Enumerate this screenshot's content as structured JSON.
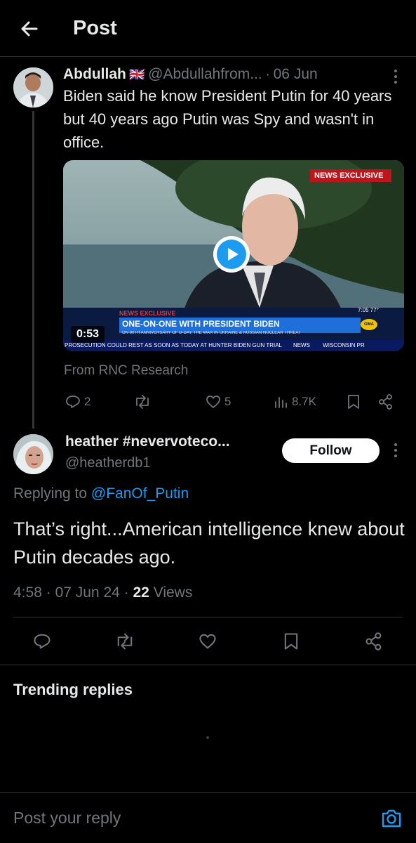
{
  "header": {
    "title": "Post"
  },
  "parent": {
    "name": "Abdullah",
    "flag": "🇬🇧",
    "handle": "@Abdullahfrom...",
    "separator": "·",
    "date": "06 Jun",
    "text": "Biden said he know President Putin for 40 years but 40 years ago Putin was Spy and wasn't in office.",
    "video": {
      "duration": "0:53",
      "network": "NEWS",
      "exclusive_tag": "EXCLUSIVE",
      "lower_exclusive": "NEWS EXCLUSIVE",
      "headline": "ONE-ON-ONE WITH PRESIDENT BIDEN",
      "subheadline": "ON 80TH ANNIVERSARY OF D-DAY, THE WAR IN UKRAINE & RUSSIAN NUCLEAR THREAT",
      "ticker": "PROSECUTION COULD REST AS SOON AS TODAY AT HUNTER BIDEN GUN TRIAL",
      "ticker_network": "NEWS",
      "ticker_right": "WISCONSIN PR",
      "time_temp": "7:05 77°",
      "badge": "GMA"
    },
    "source": "From RNC Research",
    "replies": "2",
    "likes": "5",
    "views": "8.7K"
  },
  "reply": {
    "name": "heather #nevervoteco...",
    "handle": "@heatherdb1",
    "follow_label": "Follow",
    "replying_prefix": "Replying to",
    "replying_to": "@FanOf_Putin",
    "text": "That’s right...American intelligence knew about Putin decades ago.",
    "time": "4:58",
    "date": "07 Jun 24",
    "views_count": "22",
    "views_label": "Views"
  },
  "trending": {
    "title": "Trending replies"
  },
  "composer": {
    "placeholder": "Post your reply"
  },
  "colors": {
    "accent": "#1d9bf0",
    "background": "#000000",
    "muted": "#71767b"
  }
}
